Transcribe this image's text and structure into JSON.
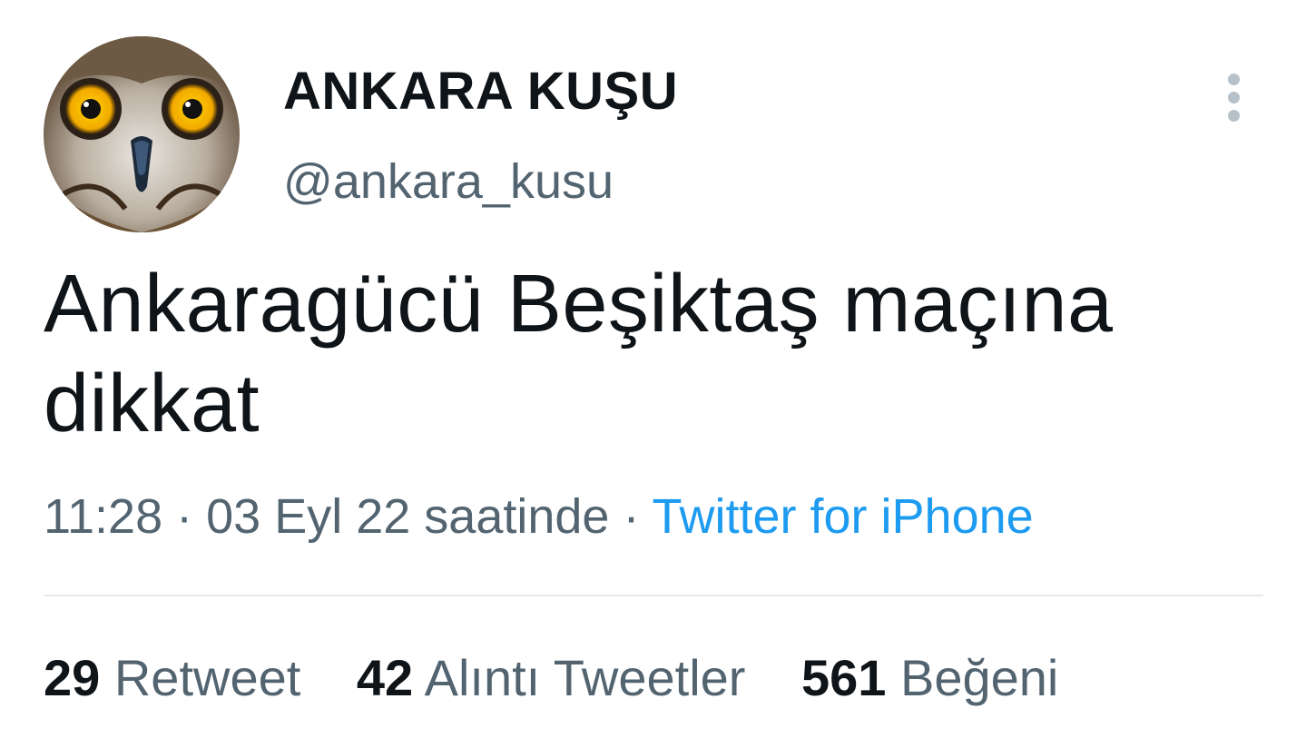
{
  "user": {
    "display_name": "ANKARA KUŞU",
    "handle": "@ankara_kusu",
    "avatar_icon": "owl-face-avatar"
  },
  "tweet": {
    "text": "Ankaragücü Beşiktaş maçına dikkat",
    "time": "11:28",
    "separator": "·",
    "date": "03 Eyl 22 saatinde",
    "source": "Twitter for iPhone"
  },
  "stats": {
    "retweets_count": "29",
    "retweets_label": "Retweet",
    "quotes_count": "42",
    "quotes_label": "Alıntı Tweetler",
    "likes_count": "561",
    "likes_label": "Beğeni"
  },
  "colors": {
    "text_primary": "#0f1419",
    "text_secondary": "#536471",
    "link": "#1d9bf0",
    "divider": "#e6eaec"
  },
  "more_icon": "more-vertical-icon"
}
